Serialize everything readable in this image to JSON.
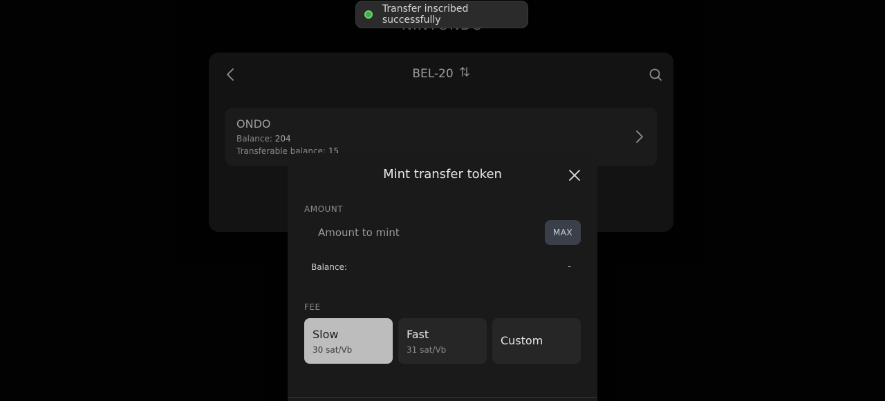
{
  "app": {
    "title": "NINTONDO"
  },
  "toast": {
    "message": "Transfer inscribed successfully",
    "status_color": "#3fae45"
  },
  "card": {
    "title": "BEL-20",
    "back_icon": "chevron-left-icon",
    "swap_icon": "swap-vertical-icon",
    "search_icon": "search-icon"
  },
  "token": {
    "name": "ONDO",
    "balance_label": "Balance:",
    "balance_value": "204",
    "transferable_label": "Transferable balance:",
    "transferable_value": "15",
    "chevron_icon": "chevron-right-icon"
  },
  "modal": {
    "title": "Mint transfer token",
    "close_icon": "close-icon",
    "amount_label": "AMOUNT",
    "amount_placeholder": "Amount to mint",
    "amount_value": "",
    "max_label": "MAX",
    "balance_label": "Balance:",
    "balance_value": "-",
    "fee_label": "FEE",
    "fee_options": [
      {
        "name": "Slow",
        "rate": "30 sat/Vb",
        "selected": true
      },
      {
        "name": "Fast",
        "rate": "31 sat/Vb",
        "selected": false
      },
      {
        "name": "Custom",
        "rate": "",
        "selected": false
      }
    ]
  },
  "colors": {
    "background": "#030303",
    "card": "#1e1e1e",
    "modal": "#1a1a1a",
    "selected_fee": "#bdbdbd",
    "max_button": "#3a4049"
  }
}
